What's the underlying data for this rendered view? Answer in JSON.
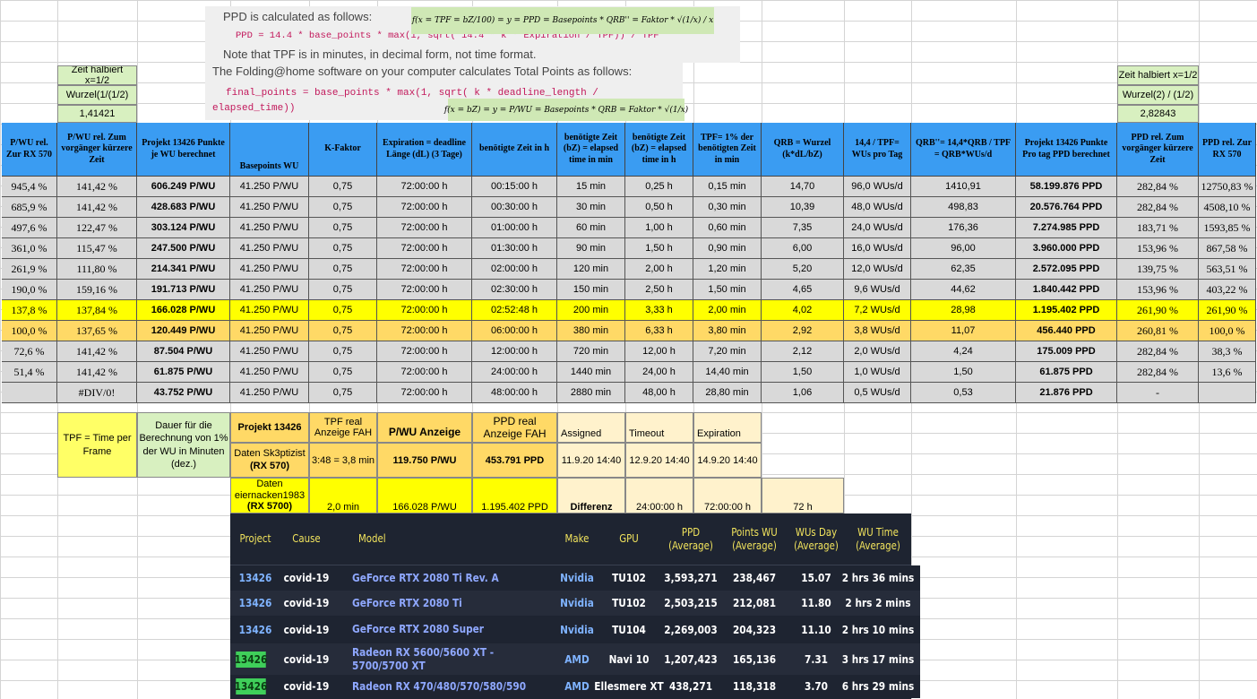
{
  "formulas": {
    "ppd_title": "PPD is calculated as follows:",
    "ppd_code": "PPD = 14.4 * base_points * max(1, sqrt( 14.4 * k * Expiration / TPF)) / TPF",
    "ppd_note": "Note that TPF is in minutes, in decimal form, not time format.",
    "tp_title": "The Folding@home software on your computer calculates Total Points as follows:",
    "tp_code_1": "final_points = base_points * max(1, sqrt( k * deadline_length /",
    "tp_code_2": "elapsed_time))",
    "math_1": "f(x = TPF = bZ/100) = y = PPD = Basepoints * QRB'' = Faktor * √(1/x) / x",
    "math_2": "f(x = bZ) = y = P/WU = Basepoints * QRB = Faktor * √(1/x)"
  },
  "left_notes": [
    "Zeit halbiert x=1/2",
    "Wurzel(1/(1/2)",
    "1,41421"
  ],
  "right_notes": [
    "Zeit halbiert x=1/2",
    "Wurzel(2) / (1/2)",
    "2,82843"
  ],
  "headers": [
    "P/WU rel. Zur RX 570",
    "P/WU rel. Zum vorgänger kürzere Zeit",
    "Projekt 13426 Punkte je WU berechnet",
    "Basepoints WU",
    "K-Faktor",
    "Expiration = deadline Länge (dL) (3 Tage)",
    "benötigte Zeit in h",
    "benötigte Zeit (bZ) = elapsed time in min",
    "benötigte Zeit (bZ) = elapsed time in h",
    "TPF= 1% der benötigten Zeit in min",
    "QRB = Wurzel (k*dL/bZ)",
    "14,4 / TPF= WUs pro Tag",
    "QRB''= 14,4*QRB / TPF = QRB*WUs/d",
    "Projekt 13426 Punkte Pro tag PPD berechnet",
    "PPD rel. Zum vorgänger kürzere Zeit",
    "PPD rel. Zur RX 570"
  ],
  "rows": [
    [
      "945,4 %",
      "141,42 %",
      "606.249 P/WU",
      "41.250 P/WU",
      "0,75",
      "72:00:00 h",
      "00:15:00 h",
      "15 min",
      "0,25 h",
      "0,15 min",
      "14,70",
      "96,0 WUs/d",
      "1410,91",
      "58.199.876 PPD",
      "282,84 %",
      "12750,83 %"
    ],
    [
      "685,9 %",
      "141,42 %",
      "428.683 P/WU",
      "41.250 P/WU",
      "0,75",
      "72:00:00 h",
      "00:30:00 h",
      "30 min",
      "0,50 h",
      "0,30 min",
      "10,39",
      "48,0 WUs/d",
      "498,83",
      "20.576.764 PPD",
      "282,84 %",
      "4508,10 %"
    ],
    [
      "497,6 %",
      "122,47 %",
      "303.124 P/WU",
      "41.250 P/WU",
      "0,75",
      "72:00:00 h",
      "01:00:00 h",
      "60 min",
      "1,00 h",
      "0,60 min",
      "7,35",
      "24,0 WUs/d",
      "176,36",
      "7.274.985 PPD",
      "183,71 %",
      "1593,85 %"
    ],
    [
      "361,0 %",
      "115,47 %",
      "247.500 P/WU",
      "41.250 P/WU",
      "0,75",
      "72:00:00 h",
      "01:30:00 h",
      "90 min",
      "1,50 h",
      "0,90 min",
      "6,00",
      "16,0 WUs/d",
      "96,00",
      "3.960.000 PPD",
      "153,96 %",
      "867,58 %"
    ],
    [
      "261,9 %",
      "111,80 %",
      "214.341 P/WU",
      "41.250 P/WU",
      "0,75",
      "72:00:00 h",
      "02:00:00 h",
      "120 min",
      "2,00 h",
      "1,20 min",
      "5,20",
      "12,0 WUs/d",
      "62,35",
      "2.572.095 PPD",
      "139,75 %",
      "563,51 %"
    ],
    [
      "190,0 %",
      "159,16 %",
      "191.713 P/WU",
      "41.250 P/WU",
      "0,75",
      "72:00:00 h",
      "02:30:00 h",
      "150 min",
      "2,50 h",
      "1,50 min",
      "4,65",
      "9,6 WUs/d",
      "44,62",
      "1.840.442 PPD",
      "153,96 %",
      "403,22 %"
    ],
    [
      "137,8 %",
      "137,84 %",
      "166.028 P/WU",
      "41.250 P/WU",
      "0,75",
      "72:00:00 h",
      "02:52:48 h",
      "200 min",
      "3,33 h",
      "2,00 min",
      "4,02",
      "7,2 WUs/d",
      "28,98",
      "1.195.402 PPD",
      "261,90 %",
      "261,90 %"
    ],
    [
      "100,0 %",
      "137,65 %",
      "120.449 P/WU",
      "41.250 P/WU",
      "0,75",
      "72:00:00 h",
      "06:00:00 h",
      "380 min",
      "6,33 h",
      "3,80 min",
      "2,92",
      "3,8 WUs/d",
      "11,07",
      "456.440 PPD",
      "260,81 %",
      "100,0 %"
    ],
    [
      "72,6 %",
      "141,42 %",
      "87.504 P/WU",
      "41.250 P/WU",
      "0,75",
      "72:00:00 h",
      "12:00:00 h",
      "720 min",
      "12,00 h",
      "7,20 min",
      "2,12",
      "2,0 WUs/d",
      "4,24",
      "175.009 PPD",
      "282,84 %",
      "38,3 %"
    ],
    [
      "51,4 %",
      "141,42 %",
      "61.875 P/WU",
      "41.250 P/WU",
      "0,75",
      "72:00:00 h",
      "24:00:00 h",
      "1440 min",
      "24,00 h",
      "14,40 min",
      "1,50",
      "1,0 WUs/d",
      "1,50",
      "61.875 PPD",
      "282,84 %",
      "13,6 %"
    ],
    [
      "",
      "#DIV/0!",
      "43.752 P/WU",
      "41.250 P/WU",
      "0,75",
      "72:00:00 h",
      "48:00:00 h",
      "2880 min",
      "48,00 h",
      "28,80 min",
      "1,06",
      "0,5 WUs/d",
      "0,53",
      "21.876 PPD",
      "-",
      ""
    ]
  ],
  "lower": {
    "tpf_label": "TPF = Time per Frame",
    "dauer_label": "Dauer für die Berechnung von 1% der WU in Minuten (dez.)",
    "projekt": "Projekt 13426",
    "tpf_real": "TPF real Anzeige FAH",
    "pwu_anzeige": "P/WU Anzeige",
    "ppd_real": "PPD real Anzeige FAH",
    "assigned": "Assigned",
    "timeout": "Timeout",
    "expiration": "Expiration",
    "r1_name": "Daten Sk3ptizist",
    "r1_gpu": "(RX 570)",
    "r1_tpf": "3:48 = 3,8 min",
    "r1_pwu": "119.750 P/WU",
    "r1_ppd": "453.791 PPD",
    "r1_assigned": "11.9.20 14:40",
    "r1_timeout": "12.9.20 14:40",
    "r1_expiration": "14.9.20 14:40",
    "r2_name": "Daten eiernacken1983",
    "r2_gpu": "(RX 5700)",
    "r2_tpf": "2,0 min",
    "r2_pwu": "166.028 P/WU",
    "r2_ppd": "1.195.402 PPD",
    "r2_diff": "Differenz",
    "r2_timeout": "24:00:00 h",
    "r2_expiration": "72:00:00 h",
    "r2_extra": "72 h"
  },
  "gpu_table": {
    "headers": [
      "Project",
      "Cause",
      "Model",
      "Make",
      "GPU",
      "PPD (Average)",
      "Points WU (Average)",
      "WUs Day (Average)",
      "WU Time (Average)"
    ],
    "rows": [
      [
        "13426",
        "covid-19",
        "GeForce RTX 2080 Ti Rev. A",
        "Nvidia",
        "TU102",
        "3,593,271",
        "238,467",
        "15.07",
        "2 hrs 36 mins"
      ],
      [
        "13426",
        "covid-19",
        "GeForce RTX 2080 Ti",
        "Nvidia",
        "TU102",
        "2,503,215",
        "212,081",
        "11.80",
        "2 hrs 2 mins"
      ],
      [
        "13426",
        "covid-19",
        "GeForce RTX 2080 Super",
        "Nvidia",
        "TU104",
        "2,269,003",
        "204,323",
        "11.10",
        "2 hrs 10 mins"
      ],
      [
        "13426",
        "covid-19",
        "Radeon RX 5600/5600 XT - 5700/5700 XT",
        "AMD",
        "Navi 10",
        "1,207,423",
        "165,136",
        "7.31",
        "3 hrs 17 mins"
      ],
      [
        "13426",
        "covid-19",
        "Radeon RX 470/480/570/580/590",
        "AMD",
        "Ellesmere XT",
        "438,271",
        "118,318",
        "3.70",
        "6 hrs 29 mins"
      ]
    ]
  },
  "colors": {
    "header_blue": "#3a9cf2",
    "note_green": "#d8f0c0",
    "row_gray": "#d9d9d9",
    "row_yellow": "#ffff00",
    "row_orange": "#ffd966",
    "dark_bg": "#1e2431"
  }
}
